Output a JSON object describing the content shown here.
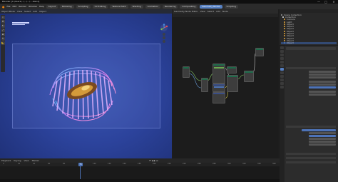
{
  "window": {
    "title": "Blender [C:\\Users\\...\\...\\...\\....blend]",
    "controls": [
      "—",
      "□",
      "✕"
    ]
  },
  "menu": {
    "items": [
      "File",
      "Edit",
      "Render",
      "Window",
      "Help"
    ],
    "workspaces": [
      "Layout",
      "Modeling",
      "Sculpting",
      "UV Editing",
      "Texture Paint",
      "Shading",
      "Animation",
      "Rendering",
      "Compositing",
      "Geometry Nodes",
      "Scripting"
    ],
    "active_workspace": "Geometry Nodes"
  },
  "viewport": {
    "header": [
      "Object Mode",
      "View",
      "Select",
      "Add",
      "Object"
    ],
    "tools": [
      "cursor-icon",
      "move-icon",
      "rotate-icon",
      "scale-icon",
      "transform-icon",
      "annotate-icon",
      "measure-icon"
    ]
  },
  "node_editor": {
    "header": [
      "Geometry Node Editor",
      "View",
      "Select",
      "Add",
      "Node"
    ]
  },
  "outliner": {
    "items": [
      {
        "label": "Scene Collection",
        "color": "#9a9a9a"
      },
      {
        "label": "Collection",
        "color": "#e3e3e3"
      },
      {
        "label": "Camera",
        "color": "#e0a33a"
      },
      {
        "label": "Light",
        "color": "#e0a33a"
      },
      {
        "label": "Object",
        "color": "#e0a33a"
      },
      {
        "label": "Object",
        "color": "#e0a33a"
      },
      {
        "label": "Object",
        "color": "#e0a33a"
      },
      {
        "label": "Object",
        "color": "#e0a33a"
      },
      {
        "label": "Object",
        "color": "#e0a33a"
      },
      {
        "label": "Object",
        "color": "#e0a33a"
      },
      {
        "label": "Object",
        "color": "#e0a33a"
      },
      {
        "label": "Object",
        "color": "#e0a33a"
      },
      {
        "label": "Object",
        "color": "#4d73b8"
      }
    ]
  },
  "timeline": {
    "header": [
      "Playback",
      "Keying",
      "View",
      "Marker"
    ],
    "ticks": [
      "0",
      "20",
      "40",
      "60",
      "80",
      "100",
      "120",
      "140",
      "160",
      "180",
      "200",
      "220",
      "240",
      "260",
      "280",
      "300",
      "320",
      "340",
      "360"
    ],
    "current_frame": "75"
  },
  "colors": {
    "accent": "#5680c2",
    "viewport_bg": "#2c439c"
  }
}
